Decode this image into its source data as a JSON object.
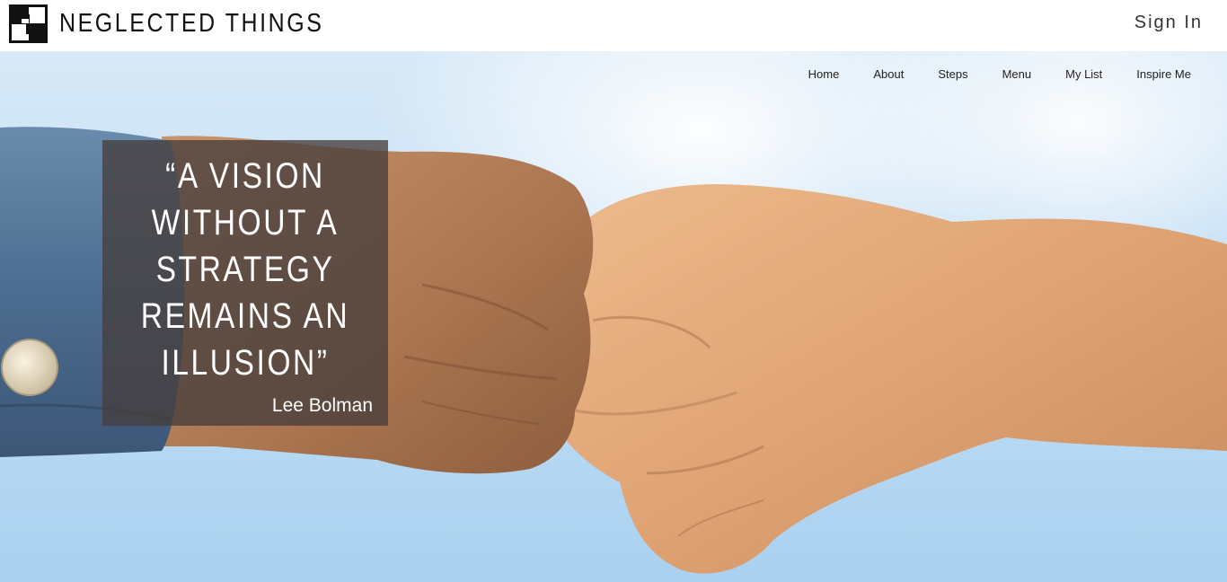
{
  "header": {
    "brand": "NEGLECTED THINGS",
    "logo_icon": "checkered-square-logo",
    "sign_in": "Sign In"
  },
  "nav": {
    "items": [
      {
        "label": "Home"
      },
      {
        "label": "About"
      },
      {
        "label": "Steps"
      },
      {
        "label": "Menu"
      },
      {
        "label": "My List"
      },
      {
        "label": "Inspire Me"
      }
    ]
  },
  "hero": {
    "image": "fist-bump-photo",
    "quote": "“A VISION\nWITHOUT A\nSTRATEGY\nREMAINS AN\nILLUSION”",
    "author": "Lee Bolman"
  },
  "colors": {
    "quote_box": "#463e3c",
    "sky": "#c4dff4",
    "skin_left": "#b8845e",
    "skin_right": "#e0a878",
    "denim": "#4d6f92"
  }
}
